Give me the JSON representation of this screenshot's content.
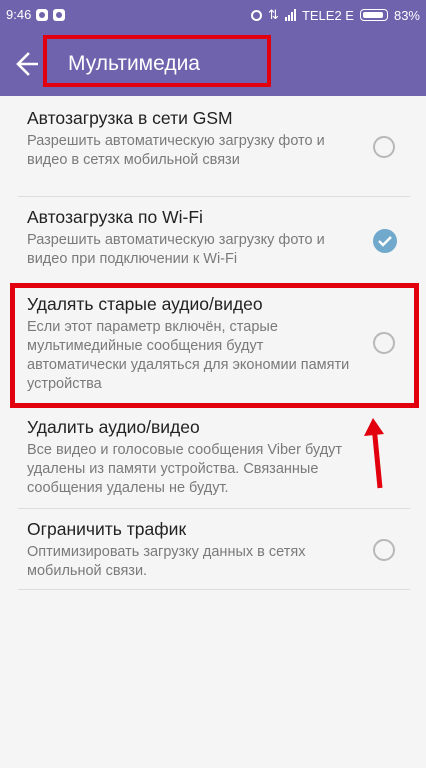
{
  "status_bar": {
    "time": "9:46",
    "carrier": "TELE2 E",
    "battery": "83%",
    "battery_level": 0.83,
    "left_icons": [
      "viber-notification-icon",
      "viber-notification-icon"
    ],
    "right_icons": [
      "alarm-icon",
      "data-transfer-icon",
      "signal-icon",
      "battery-icon"
    ]
  },
  "toolbar": {
    "title": "Мультимедиа",
    "back_icon": "arrow-left-icon",
    "background": "#6f63ad"
  },
  "settings": [
    {
      "title": "Автозагрузка в сети GSM",
      "description": "Разрешить автоматическую загрузку фото и видео в сетях мобильной связи",
      "control": "radio",
      "checked": false
    },
    {
      "title": "Автозагрузка по Wi-Fi",
      "description": "Разрешить автоматическую загрузку фото и видео при подключении к Wi-Fi",
      "control": "radio",
      "checked": true
    },
    {
      "title": "Удалять старые аудио/видео",
      "description": "Если этот параметр включён, старые мультимедийные сообщения будут автоматически удаляться для экономии памяти устройства",
      "control": "radio",
      "checked": false
    },
    {
      "title": "Удалить аудио/видео",
      "description": "Все видео и голосовые сообщения Viber будут удалены из памяти устройства. Связанные сообщения удалены не будут.",
      "control": "none"
    },
    {
      "title": "Ограничить трафик",
      "description": "Оптимизировать загрузку данных в сетях мобильной связи.",
      "control": "radio",
      "checked": false
    }
  ],
  "annotations": {
    "highlight_color": "#e3000e"
  }
}
